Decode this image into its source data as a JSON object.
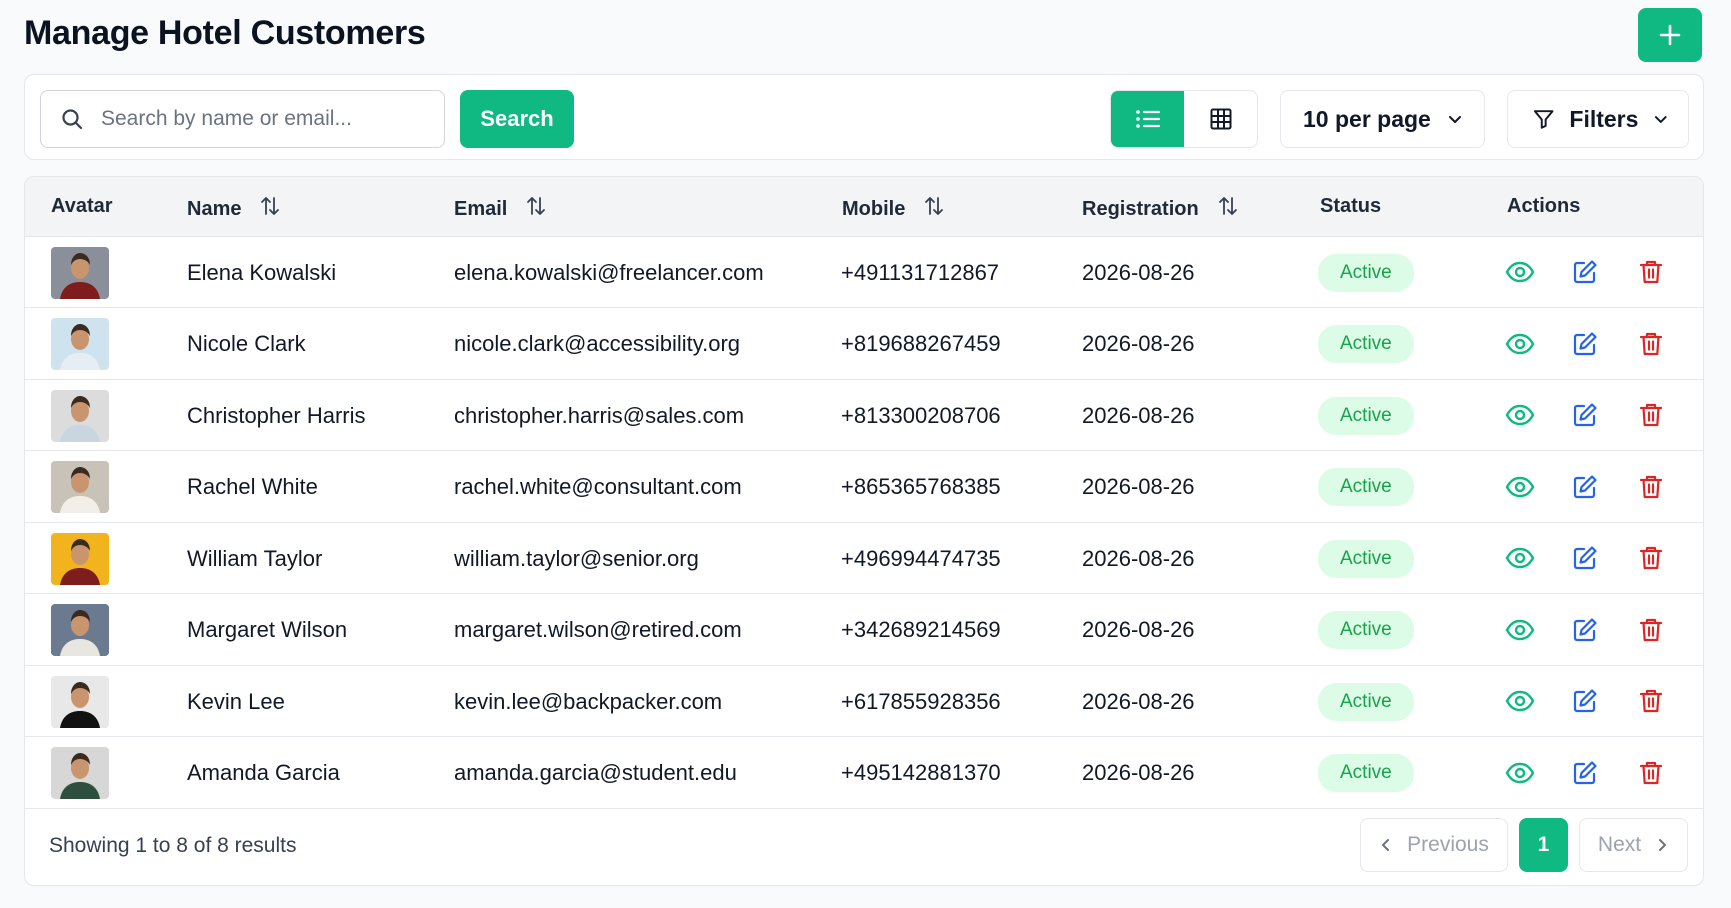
{
  "header": {
    "title": "Manage Hotel Customers",
    "add_icon": "plus-icon"
  },
  "toolbar": {
    "search_placeholder": "Search by name or email...",
    "search_value": "",
    "search_button": "Search",
    "view_mode": "list",
    "per_page": "10 per page",
    "filters_label": "Filters"
  },
  "table": {
    "columns": {
      "avatar": "Avatar",
      "name": "Name",
      "email": "Email",
      "mobile": "Mobile",
      "registration": "Registration",
      "status": "Status",
      "actions": "Actions"
    },
    "rows": [
      {
        "name": "Elena Kowalski",
        "email": "elena.kowalski@freelancer.com",
        "mobile": "+491131712867",
        "registration": "2026-08-26",
        "status": "Active",
        "avatar_bg": "#8b8f99",
        "shirt": "#7f1d1d"
      },
      {
        "name": "Nicole Clark",
        "email": "nicole.clark@accessibility.org",
        "mobile": "+819688267459",
        "registration": "2026-08-26",
        "status": "Active",
        "avatar_bg": "#cfe3ef",
        "shirt": "#e5eef5"
      },
      {
        "name": "Christopher Harris",
        "email": "christopher.harris@sales.com",
        "mobile": "+813300208706",
        "registration": "2026-08-26",
        "status": "Active",
        "avatar_bg": "#dcdcdc",
        "shirt": "#c9d6e2"
      },
      {
        "name": "Rachel White",
        "email": "rachel.white@consultant.com",
        "mobile": "+865365768385",
        "registration": "2026-08-26",
        "status": "Active",
        "avatar_bg": "#c8c2b8",
        "shirt": "#f2efe9"
      },
      {
        "name": "William Taylor",
        "email": "william.taylor@senior.org",
        "mobile": "+496994474735",
        "registration": "2026-08-26",
        "status": "Active",
        "avatar_bg": "#f2b41d",
        "shirt": "#7f1d1d"
      },
      {
        "name": "Margaret Wilson",
        "email": "margaret.wilson@retired.com",
        "mobile": "+342689214569",
        "registration": "2026-08-26",
        "status": "Active",
        "avatar_bg": "#6b7a8f",
        "shirt": "#e8e6e0"
      },
      {
        "name": "Kevin Lee",
        "email": "kevin.lee@backpacker.com",
        "mobile": "+617855928356",
        "registration": "2026-08-26",
        "status": "Active",
        "avatar_bg": "#e8e8e8",
        "shirt": "#111111"
      },
      {
        "name": "Amanda Garcia",
        "email": "amanda.garcia@student.edu",
        "mobile": "+495142881370",
        "registration": "2026-08-26",
        "status": "Active",
        "avatar_bg": "#d7d7d7",
        "shirt": "#2f4f3e"
      }
    ]
  },
  "footer": {
    "summary": "Showing 1 to 8 of 8 results",
    "previous": "Previous",
    "current_page": "1",
    "next": "Next"
  },
  "colors": {
    "accent": "#10b981",
    "view_icon": "#10b981",
    "edit_icon": "#2563eb",
    "delete_icon": "#dc2626",
    "badge_bg": "#dcfce7",
    "badge_text": "#16a34a"
  }
}
